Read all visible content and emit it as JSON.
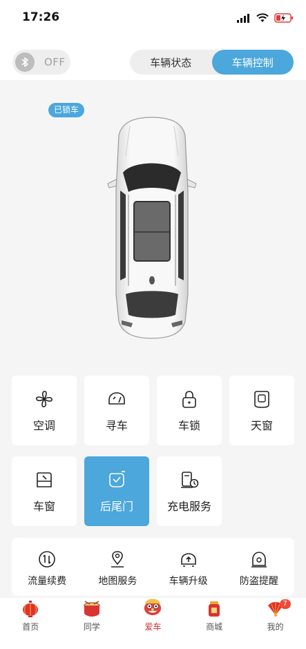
{
  "status_bar": {
    "time": "17:26"
  },
  "header": {
    "bluetooth": {
      "state_label": "OFF",
      "icon": "bluetooth-icon"
    },
    "tabs": [
      {
        "label": "车辆状态",
        "active": false
      },
      {
        "label": "车辆控制",
        "active": true
      }
    ]
  },
  "car": {
    "lock_status": "已锁车"
  },
  "controls": {
    "row1": [
      {
        "label": "空调",
        "icon": "fan-icon",
        "active": false
      },
      {
        "label": "寻车",
        "icon": "find-car-icon",
        "active": false
      },
      {
        "label": "车锁",
        "icon": "lock-icon",
        "active": false
      },
      {
        "label": "天窗",
        "icon": "sunroof-icon",
        "active": false
      }
    ],
    "row2": [
      {
        "label": "车窗",
        "icon": "window-icon",
        "active": false
      },
      {
        "label": "后尾门",
        "icon": "tailgate-icon",
        "active": true
      },
      {
        "label": "充电服务",
        "icon": "charging-icon",
        "active": false
      }
    ]
  },
  "services": [
    {
      "label": "流量续费",
      "icon": "data-renew-icon"
    },
    {
      "label": "地图服务",
      "icon": "map-pin-icon"
    },
    {
      "label": "车辆升级",
      "icon": "car-upgrade-icon"
    },
    {
      "label": "防盗提醒",
      "icon": "anti-theft-icon"
    }
  ],
  "tabbar": [
    {
      "label": "首页",
      "icon": "lantern-icon",
      "active": false
    },
    {
      "label": "同学",
      "icon": "drum-icon",
      "active": false
    },
    {
      "label": "爱车",
      "icon": "lion-dance-icon",
      "active": true
    },
    {
      "label": "商城",
      "icon": "gift-jar-icon",
      "active": false
    },
    {
      "label": "我的",
      "icon": "fan-festive-icon",
      "active": false,
      "badge": "7"
    }
  ],
  "colors": {
    "accent": "#4ba7dc",
    "tab_active": "#d4282c",
    "badge": "#ef4a3a"
  }
}
